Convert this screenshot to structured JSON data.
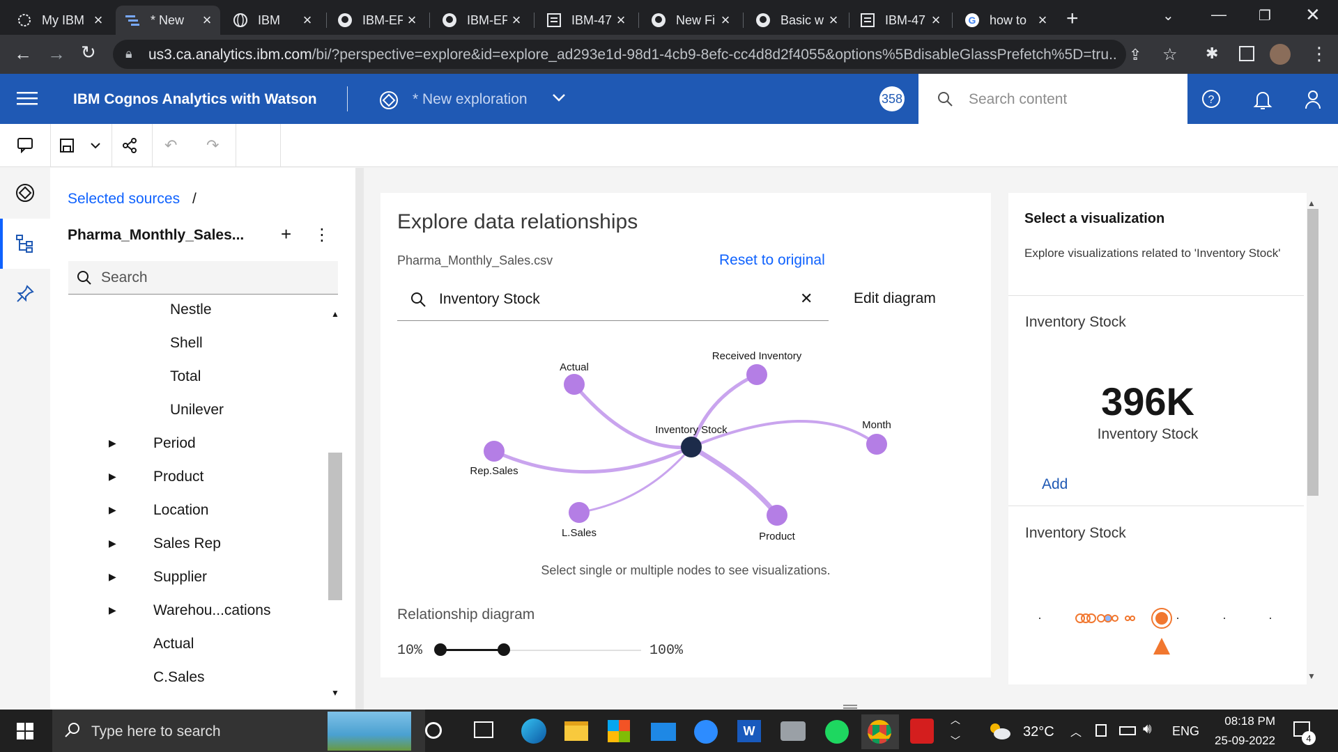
{
  "browser": {
    "tabs": [
      {
        "label": "My IBM",
        "icon": "ibm-icon"
      },
      {
        "label": "* New",
        "icon": "cognos-icon"
      },
      {
        "label": "IBM",
        "icon": "globe-icon"
      },
      {
        "label": "IBM-EF",
        "icon": "github-icon"
      },
      {
        "label": "IBM-EF",
        "icon": "github-icon"
      },
      {
        "label": "IBM-47",
        "icon": "doc-icon"
      },
      {
        "label": "New Fi",
        "icon": "github-icon"
      },
      {
        "label": "Basic w",
        "icon": "github-icon"
      },
      {
        "label": "IBM-47",
        "icon": "doc-icon"
      },
      {
        "label": "how to",
        "icon": "google-icon"
      }
    ],
    "url_host": "us3.ca.analytics.ibm.com",
    "url_path": "/bi/?perspective=explore&id=explore_ad293e1d-98d1-4cb9-8efc-cc4d8d2f4055&options%5BdisableGlassPrefetch%5D=tru..."
  },
  "header": {
    "app_title": "IBM Cognos Analytics with Watson",
    "exploration_title": "* New exploration",
    "badge": "358",
    "search_placeholder": "Search content"
  },
  "sources": {
    "breadcrumb": "Selected sources",
    "breadcrumb_sep": "/",
    "dataset": "Pharma_Monthly_Sales...",
    "search_placeholder": "Search",
    "sub_items": [
      "Nestle",
      "Shell",
      "Total",
      "Unilever"
    ],
    "groups": [
      "Period",
      "Product",
      "Location",
      "Sales Rep",
      "Supplier",
      "Warehou...cations"
    ],
    "measures": [
      "Actual",
      "C.Sales"
    ]
  },
  "explore": {
    "title": "Explore data relationships",
    "file": "Pharma_Monthly_Sales.csv",
    "reset": "Reset to original",
    "search_value": "Inventory Stock",
    "edit": "Edit diagram",
    "hint": "Select single or multiple nodes to see visualizations.",
    "relationship_label": "Relationship diagram",
    "slider_min": "10%",
    "slider_max": "100%",
    "nodes": {
      "center": "Inventory Stock",
      "actual": "Actual",
      "received": "Received Inventory",
      "month": "Month",
      "repsales": "Rep.Sales",
      "lsales": "L.Sales",
      "product": "Product"
    }
  },
  "viz": {
    "title": "Select a visualization",
    "subtitle": "Explore visualizations related to 'Inventory Stock'",
    "card1_title": "Inventory Stock",
    "kpi_value": "396K",
    "kpi_label": "Inventory Stock",
    "add": "Add",
    "card2_title": "Inventory Stock"
  },
  "taskbar": {
    "search_placeholder": "Type here to search",
    "weather": "32°C",
    "lang": "ENG",
    "time": "08:18 PM",
    "date": "25-09-2022",
    "notifications": "4"
  },
  "colors": {
    "ibm_blue": "#1f59b4",
    "node_purple": "#b47ee5",
    "edge_purple": "#c9a4ee",
    "node_dark": "#1c2b4a",
    "link_blue": "#0f62fe",
    "orange": "#f1772f"
  }
}
